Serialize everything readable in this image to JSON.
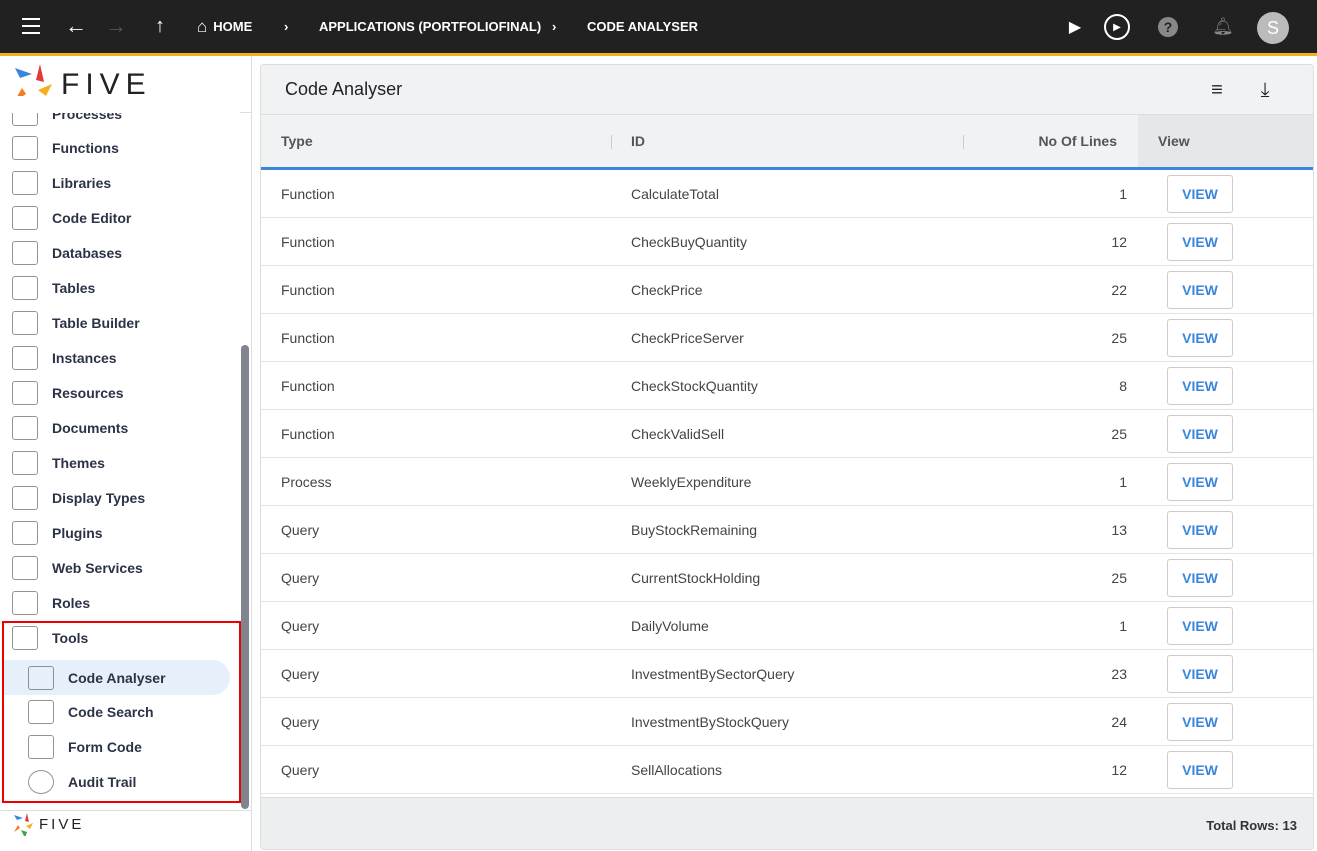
{
  "topbar": {
    "breadcrumb": [
      {
        "label": "HOME"
      },
      {
        "label": "APPLICATIONS (PORTFOLIOFINAL)"
      },
      {
        "label": "CODE ANALYSER"
      }
    ],
    "avatar": "S"
  },
  "sidebar": {
    "logo": "FIVE",
    "items": [
      {
        "label": "Processes"
      },
      {
        "label": "Functions"
      },
      {
        "label": "Libraries"
      },
      {
        "label": "Code Editor"
      },
      {
        "label": "Databases"
      },
      {
        "label": "Tables"
      },
      {
        "label": "Table Builder"
      },
      {
        "label": "Instances"
      },
      {
        "label": "Resources"
      },
      {
        "label": "Documents"
      },
      {
        "label": "Themes"
      },
      {
        "label": "Display Types"
      },
      {
        "label": "Plugins"
      },
      {
        "label": "Web Services"
      },
      {
        "label": "Roles"
      },
      {
        "label": "Tools"
      }
    ],
    "subitems": [
      {
        "label": "Code Analyser"
      },
      {
        "label": "Code Search"
      },
      {
        "label": "Form Code"
      },
      {
        "label": "Audit Trail"
      }
    ],
    "footer_logo": "FIVE"
  },
  "main": {
    "title": "Code Analyser",
    "columns": [
      "Type",
      "ID",
      "No Of Lines",
      "View"
    ],
    "rows": [
      {
        "type": "Function",
        "id": "CalculateTotal",
        "lines": "1",
        "view": "VIEW"
      },
      {
        "type": "Function",
        "id": "CheckBuyQuantity",
        "lines": "12",
        "view": "VIEW"
      },
      {
        "type": "Function",
        "id": "CheckPrice",
        "lines": "22",
        "view": "VIEW"
      },
      {
        "type": "Function",
        "id": "CheckPriceServer",
        "lines": "25",
        "view": "VIEW"
      },
      {
        "type": "Function",
        "id": "CheckStockQuantity",
        "lines": "8",
        "view": "VIEW"
      },
      {
        "type": "Function",
        "id": "CheckValidSell",
        "lines": "25",
        "view": "VIEW"
      },
      {
        "type": "Process",
        "id": "WeeklyExpenditure",
        "lines": "1",
        "view": "VIEW"
      },
      {
        "type": "Query",
        "id": "BuyStockRemaining",
        "lines": "13",
        "view": "VIEW"
      },
      {
        "type": "Query",
        "id": "CurrentStockHolding",
        "lines": "25",
        "view": "VIEW"
      },
      {
        "type": "Query",
        "id": "DailyVolume",
        "lines": "1",
        "view": "VIEW"
      },
      {
        "type": "Query",
        "id": "InvestmentBySectorQuery",
        "lines": "23",
        "view": "VIEW"
      },
      {
        "type": "Query",
        "id": "InvestmentByStockQuery",
        "lines": "24",
        "view": "VIEW"
      },
      {
        "type": "Query",
        "id": "SellAllocations",
        "lines": "12",
        "view": "VIEW"
      }
    ],
    "total_rows": "Total Rows: 13"
  },
  "colors": {
    "topbar": "#212121",
    "accent": "#f2b01e",
    "link": "#3a86d8",
    "selection_box": "#e00000"
  }
}
